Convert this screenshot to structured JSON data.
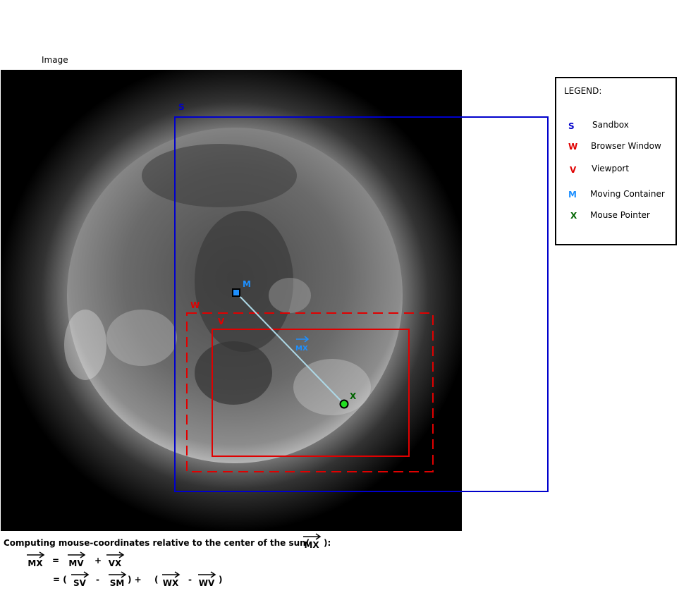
{
  "image_label": "Image",
  "regions": {
    "sandbox": {
      "key": "S",
      "color": "#0000cc"
    },
    "browser_window": {
      "key": "W",
      "color": "#e00000"
    },
    "viewport": {
      "key": "V",
      "color": "#e00000"
    },
    "moving_container": {
      "key": "M",
      "color": "#1e90ff"
    },
    "mouse_pointer": {
      "key": "X",
      "color": "#006400"
    },
    "vector_label": "MX"
  },
  "legend": {
    "title": "LEGEND:",
    "items": [
      {
        "key": "S",
        "label": "Sandbox",
        "color": "#0000cc"
      },
      {
        "key": "W",
        "label": "Browser Window",
        "color": "#e00000"
      },
      {
        "key": "V",
        "label": "Viewport",
        "color": "#e00000"
      },
      {
        "key": "M",
        "label": "Moving Container",
        "color": "#1e90ff"
      },
      {
        "key": "X",
        "label": "Mouse Pointer",
        "color": "#006400"
      }
    ]
  },
  "formula": {
    "heading": "Computing mouse-coordinates relative to the center of the sun(",
    "heading_vec": "MX",
    "heading_end": "):",
    "line1": {
      "lhs": "MX",
      "eq": "=",
      "a": "MV",
      "plus": "+",
      "b": "VX"
    },
    "line2": {
      "eq": "= (",
      "a": "SV",
      "minus1": "-",
      "b": "SM",
      "close_plus": ")  +",
      "open": "(",
      "c": "WX",
      "minus2": "-",
      "d": "WV",
      "close": ")"
    }
  }
}
